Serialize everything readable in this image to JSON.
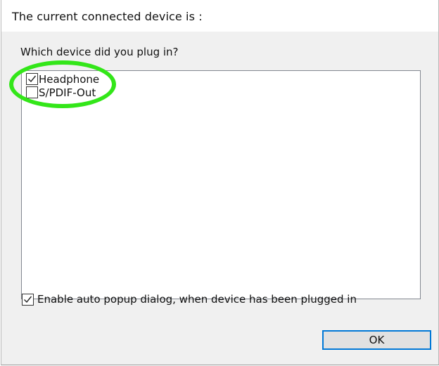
{
  "window": {
    "title": "The current connected device is :"
  },
  "dialog": {
    "prompt": "Which device did you plug in?",
    "devices": [
      {
        "label": "Headphone",
        "checked": true
      },
      {
        "label": "S/PDIF-Out",
        "checked": false
      }
    ],
    "auto_popup": {
      "label": "Enable auto popup dialog, when device has been plugged in",
      "checked": true
    },
    "ok_label": "OK"
  },
  "colors": {
    "highlight": "#33e619",
    "button_border": "#0078d7",
    "dialog_background": "#f0f0f0"
  }
}
